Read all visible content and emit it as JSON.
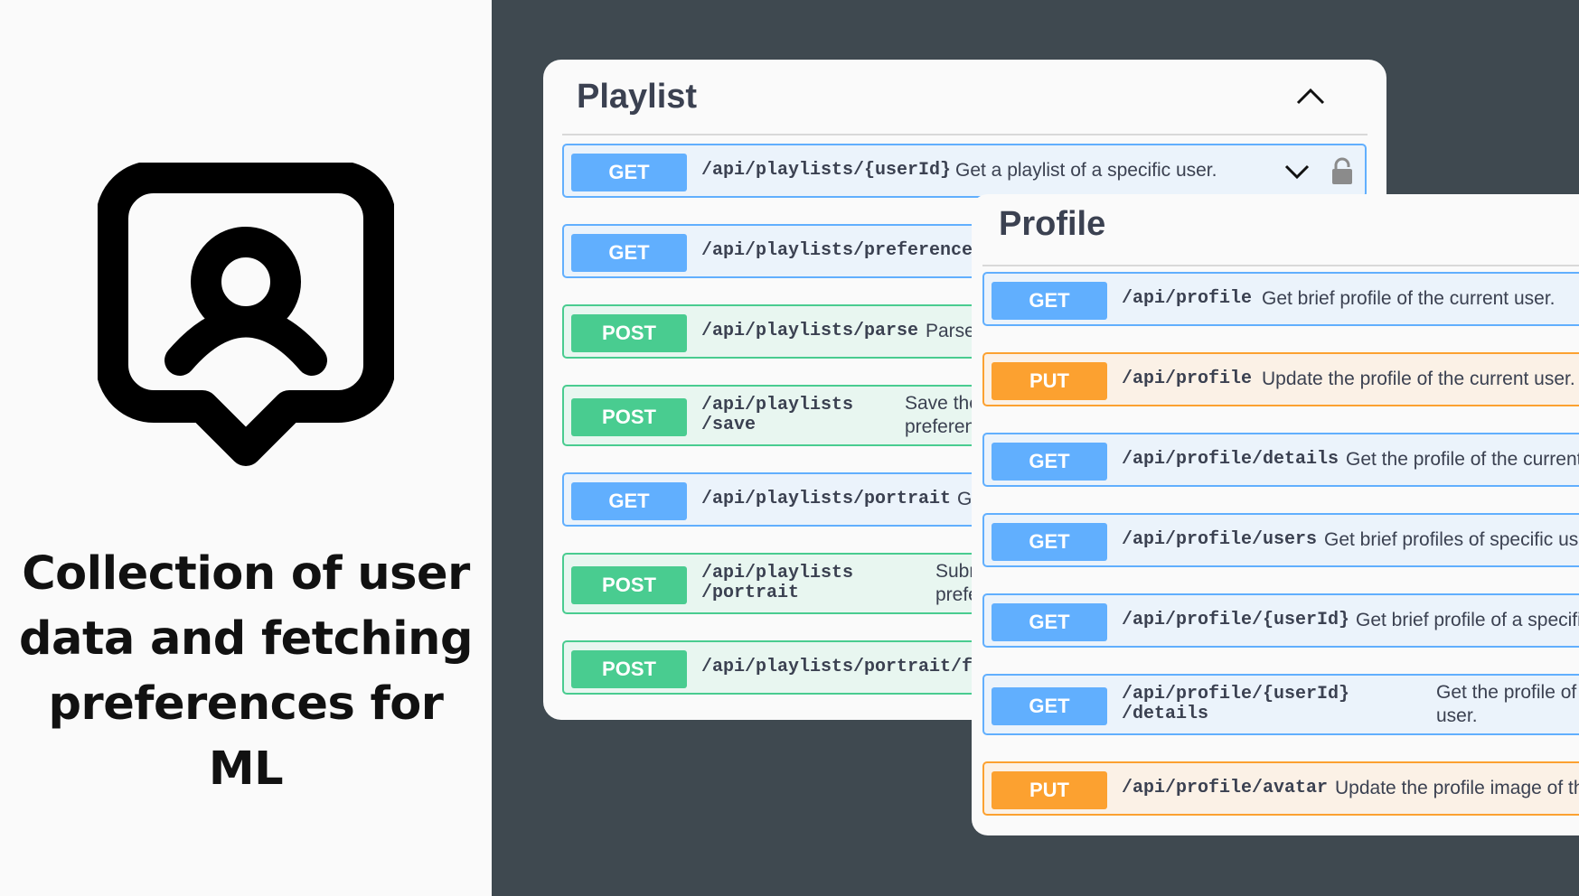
{
  "caption": {
    "lines": [
      "Collection of user",
      "data and fetching",
      "preferences for ML"
    ]
  },
  "colors": {
    "get": "#61affe",
    "post": "#49cc90",
    "put": "#fca130",
    "background_dark": "#3f4950"
  },
  "playlist": {
    "title": "Playlist",
    "collapse_icon": "chevron-up-icon",
    "operations": [
      {
        "method": "GET",
        "path": "/api/playlists/{userId}",
        "description": "Get a playlist of a specific user.",
        "icons": [
          "chevron-down-icon",
          "lock-icon"
        ]
      },
      {
        "method": "GET",
        "path": "/api/playlists/preferences",
        "description": ""
      },
      {
        "method": "POST",
        "path": "/api/playlists/parse",
        "description": "Parse"
      },
      {
        "method": "POST",
        "path": "/api/playlists\n/save",
        "description": "Save the\npreferen"
      },
      {
        "method": "GET",
        "path": "/api/playlists/portrait",
        "description": "G"
      },
      {
        "method": "POST",
        "path": "/api/playlists\n/portrait",
        "description": "Subm\nprefe"
      },
      {
        "method": "POST",
        "path": "/api/playlists/portrait/fe",
        "description": ""
      }
    ]
  },
  "profile": {
    "title": "Profile",
    "operations": [
      {
        "method": "GET",
        "path": "/api/profile",
        "description": "Get brief profile of the current user."
      },
      {
        "method": "PUT",
        "path": "/api/profile",
        "description": "Update the profile of the current user."
      },
      {
        "method": "GET",
        "path": "/api/profile/details",
        "description": "Get the profile of the current"
      },
      {
        "method": "GET",
        "path": "/api/profile/users",
        "description": "Get brief profiles of specific use"
      },
      {
        "method": "GET",
        "path": "/api/profile/{userId}",
        "description": "Get brief profile of a specifi"
      },
      {
        "method": "GET",
        "path": "/api/profile/{userId}\n/details",
        "description": "Get the profile of\nuser."
      },
      {
        "method": "PUT",
        "path": "/api/profile/avatar",
        "description": "Update the profile image of th"
      }
    ]
  }
}
